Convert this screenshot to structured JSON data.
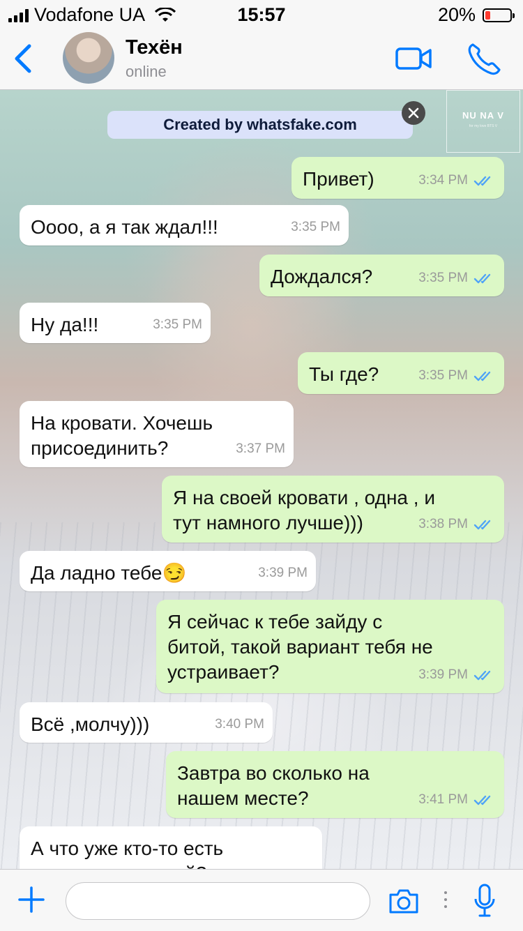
{
  "status_bar": {
    "carrier": "Vodafone UA",
    "time": "15:57",
    "battery_percent": "20%",
    "battery_level": 0.2
  },
  "header": {
    "contact_name": "Техён",
    "contact_status": "online"
  },
  "banner": {
    "text": "Created by whatsfake.com"
  },
  "wallpaper": {
    "watermark_title": "NU NA V",
    "watermark_sub": "for my love BTS V"
  },
  "colors": {
    "accent": "#007aff",
    "outgoing_bubble": "#dcf8c6",
    "incoming_bubble": "#ffffff",
    "read_ticks": "#4fa3f7",
    "battery_low": "#ff3b30"
  },
  "messages": [
    {
      "dir": "out",
      "text": "Привет)",
      "time": "3:34 PM",
      "read": true
    },
    {
      "dir": "in",
      "text": "Оооо, а я так ждал!!!",
      "time": "3:35 PM"
    },
    {
      "dir": "out",
      "text": "Дождался?",
      "time": "3:35 PM",
      "read": true
    },
    {
      "dir": "in",
      "text": "Ну да!!!",
      "time": "3:35 PM"
    },
    {
      "dir": "out",
      "text": "Ты где?",
      "time": "3:35 PM",
      "read": true
    },
    {
      "dir": "in",
      "text": "На кровати. Хочешь\nприсоединить?",
      "time": "3:37 PM"
    },
    {
      "dir": "out",
      "text": "Я на своей кровати , одна , и\nтут намного лучше)))",
      "time": "3:38 PM",
      "read": true
    },
    {
      "dir": "in",
      "text": "Да ладно тебе😏",
      "time": "3:39 PM"
    },
    {
      "dir": "out",
      "text": "Я сейчас к тебе зайду с\nбитой, такой вариант тебя не\nустраивает?",
      "time": "3:39 PM",
      "read": true
    },
    {
      "dir": "in",
      "text": "Всё ,молчу)))",
      "time": "3:40 PM"
    },
    {
      "dir": "out",
      "text": "Завтра во сколько на\nнашем месте?",
      "time": "3:41 PM",
      "read": true
    },
    {
      "dir": "in",
      "text": "А что уже кто-то есть\nнеопровердливый?",
      "time": ""
    }
  ],
  "input": {
    "placeholder": "",
    "value": ""
  },
  "icons": {
    "back": "chevron-left-icon",
    "video": "video-camera-icon",
    "call": "phone-icon",
    "close": "close-icon",
    "plus": "plus-icon",
    "camera": "camera-icon",
    "mic": "microphone-icon"
  }
}
